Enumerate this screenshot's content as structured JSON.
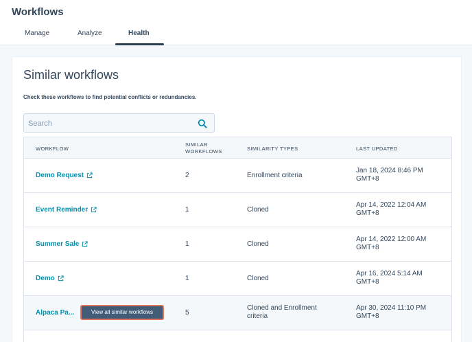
{
  "app": {
    "title": "Workflows"
  },
  "tabs": [
    {
      "label": "Manage"
    },
    {
      "label": "Analyze"
    },
    {
      "label": "Health"
    }
  ],
  "card": {
    "title": "Similar workflows",
    "subtitle": "Check these workflows to find potential conflicts or redundancies."
  },
  "search": {
    "placeholder": "Search",
    "value": ""
  },
  "table": {
    "headers": {
      "workflow": "WORKFLOW",
      "similar_1": "SIMILAR",
      "similar_2": "WORKFLOWS",
      "types": "SIMILARITY TYPES",
      "updated": "LAST UPDATED"
    },
    "rows": [
      {
        "name": "Demo Request",
        "similar": "2",
        "type_1": "Enrollment criteria",
        "type_2": "",
        "date": "Jan 18, 2024 8:46 PM",
        "tz": "GMT+8"
      },
      {
        "name": "Event Reminder",
        "similar": "1",
        "type_1": "Cloned",
        "type_2": "",
        "date": "Apr 14, 2022 12:04 AM",
        "tz": "GMT+8"
      },
      {
        "name": "Summer Sale",
        "similar": "1",
        "type_1": "Cloned",
        "type_2": "",
        "date": "Apr 14, 2022 12:00 AM",
        "tz": "GMT+8"
      },
      {
        "name": "Demo",
        "similar": "1",
        "type_1": "Cloned",
        "type_2": "",
        "date": "Apr 16, 2024 5:14 AM",
        "tz": "GMT+8"
      },
      {
        "name": "Alpaca Pa...",
        "similar": "5",
        "type_1": "Cloned and Enrollment",
        "type_2": "criteria",
        "date": "Apr 30, 2024 11:10 PM",
        "tz": "GMT+8"
      }
    ]
  },
  "tooltip_button": {
    "label": "View all similar workflows"
  },
  "colors": {
    "link": "#0091ae",
    "text": "#33475b",
    "highlight": "#e0735a",
    "tooltip_bg": "#425b76"
  },
  "icons": {
    "search": "search-icon",
    "external": "external-link-icon"
  }
}
